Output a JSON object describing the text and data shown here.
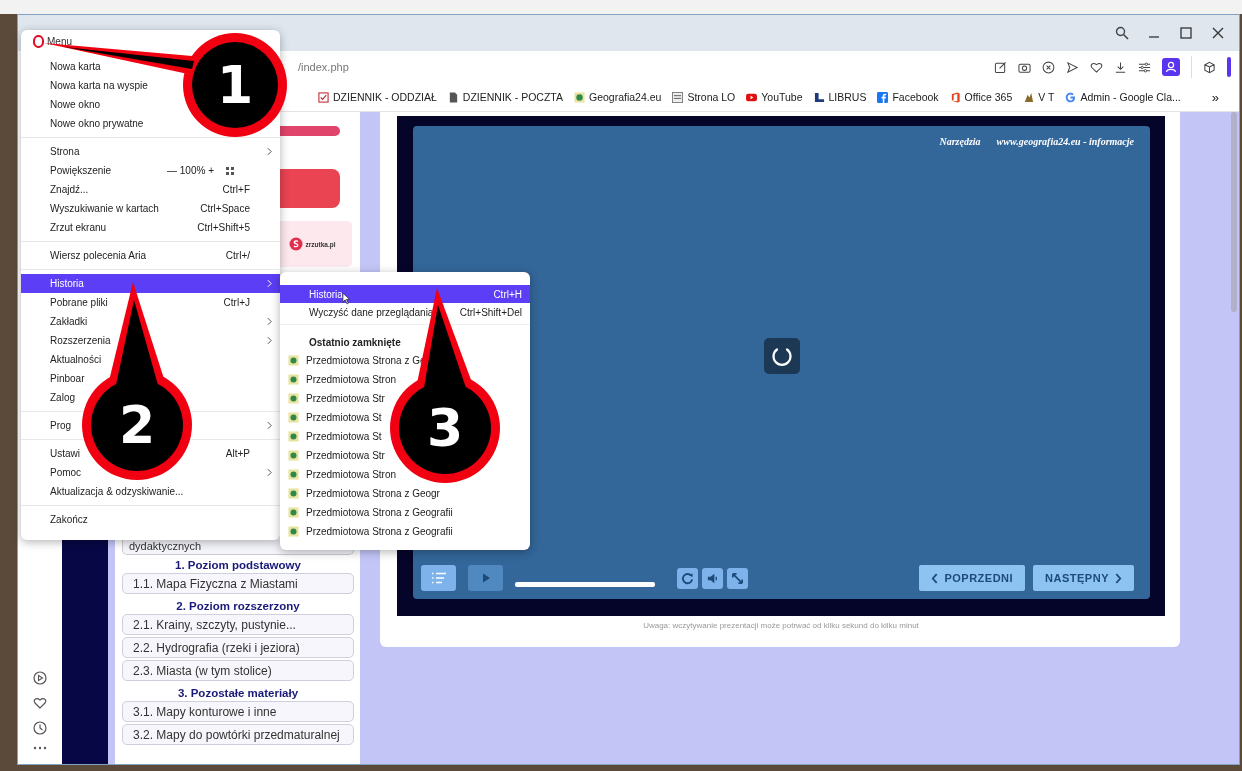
{
  "address_bar": {
    "url": "/index.php"
  },
  "bookmarks": [
    {
      "label": "DZIENNIK - ODDZIAŁ",
      "kind": "check"
    },
    {
      "label": "DZIENNIK - POCZTA",
      "kind": "doc"
    },
    {
      "label": "Geografia24.eu",
      "kind": "geo"
    },
    {
      "label": "Strona LO",
      "kind": "school"
    },
    {
      "label": "YouTube",
      "kind": "youtube"
    },
    {
      "label": "LIBRUS",
      "kind": "librus"
    },
    {
      "label": "Facebook",
      "kind": "facebook"
    },
    {
      "label": "Office 365",
      "kind": "office"
    },
    {
      "label": "V T",
      "kind": "vt"
    },
    {
      "label": "Admin - Google Cla...",
      "kind": "google"
    }
  ],
  "more_bookmarks": "»",
  "menu": {
    "title": "Menu",
    "groups": [
      {
        "items": [
          {
            "kind": "item",
            "label": "Nowa karta",
            "submenu": false,
            "selected": false
          },
          {
            "kind": "item",
            "label": "Nowa karta na wyspie",
            "submenu": false,
            "selected": false
          },
          {
            "kind": "item",
            "label": "Nowe okno",
            "submenu": false,
            "selected": false
          },
          {
            "kind": "item",
            "label": "Nowe okno prywatne",
            "submenu": false,
            "selected": false
          }
        ]
      },
      {
        "items": [
          {
            "kind": "item",
            "label": "Strona",
            "submenu": true,
            "selected": false
          },
          {
            "kind": "zoom",
            "label": "Powiększenie",
            "minus": "—",
            "value": "100%",
            "plus": "+",
            "submenu": false,
            "selected": false
          },
          {
            "kind": "item",
            "label": "Znajdź...",
            "shortcut": "Ctrl+F",
            "submenu": false,
            "selected": false
          },
          {
            "kind": "item",
            "label": "Wyszukiwanie w kartach",
            "shortcut": "Ctrl+Space",
            "submenu": false,
            "selected": false
          },
          {
            "kind": "item",
            "label": "Zrzut ekranu",
            "shortcut": "Ctrl+Shift+5",
            "submenu": false,
            "selected": false
          }
        ]
      },
      {
        "items": [
          {
            "kind": "item",
            "label": "Wiersz polecenia Aria",
            "shortcut": "Ctrl+/",
            "submenu": false,
            "selected": false
          }
        ]
      },
      {
        "items": [
          {
            "kind": "item",
            "label": "Historia",
            "submenu": true,
            "selected": true
          },
          {
            "kind": "item",
            "label": "Pobrane pliki",
            "shortcut": "Ctrl+J",
            "submenu": false,
            "selected": false
          },
          {
            "kind": "item",
            "label": "Zakładki",
            "submenu": true,
            "selected": false
          },
          {
            "kind": "item",
            "label": "Rozszerzenia",
            "submenu": true,
            "selected": false
          },
          {
            "kind": "item",
            "label": "Aktualności",
            "submenu": false,
            "selected": false
          },
          {
            "kind": "item",
            "label": "Pinboar",
            "submenu": false,
            "selected": false
          },
          {
            "kind": "item",
            "label": "Zalog",
            "submenu": false,
            "selected": false
          }
        ]
      },
      {
        "items": [
          {
            "kind": "item",
            "label": "Prog",
            "submenu": true,
            "selected": false
          }
        ]
      },
      {
        "items": [
          {
            "kind": "item",
            "label": "Ustawi",
            "shortcut": "Alt+P",
            "submenu": false,
            "selected": false
          },
          {
            "kind": "item",
            "label": "Pomoc",
            "submenu": true,
            "selected": false
          },
          {
            "kind": "item",
            "label": "Aktualizacja & odzyskiwanie...",
            "submenu": false,
            "selected": false
          }
        ]
      },
      {
        "items": [
          {
            "kind": "item",
            "label": "Zakończ",
            "submenu": false,
            "selected": false
          }
        ]
      }
    ]
  },
  "history_submenu": {
    "actions": [
      {
        "label": "Historia",
        "shortcut": "Ctrl+H",
        "selected": true
      },
      {
        "label": "Wyczyść dane przeglądania",
        "shortcut": "Ctrl+Shift+Del",
        "selected": false
      }
    ],
    "section_title": "Ostatnio zamknięte",
    "recent": [
      {
        "label": "Przedmiotowa Strona z Ge",
        "selected": false
      },
      {
        "label": "Przedmiotowa Stron",
        "selected": false
      },
      {
        "label": "Przedmiotowa Str",
        "selected": false
      },
      {
        "label": "Przedmiotowa St",
        "selected": false
      },
      {
        "label": "Przedmiotowa St",
        "selected": false
      },
      {
        "label": "Przedmiotowa Str",
        "selected": false
      },
      {
        "label": "Przedmiotowa Stron",
        "selected": false
      },
      {
        "label": "Przedmiotowa Strona z Geogr",
        "selected": false
      },
      {
        "label": "Przedmiotowa Strona z Geografii",
        "selected": false
      },
      {
        "label": "Przedmiotowa Strona z Geografii",
        "selected": false
      }
    ]
  },
  "left_panel": {
    "donate_label": "zrzutka.pl",
    "cut_text": "dydaktycznych",
    "sections": [
      {
        "heading": "1. Poziom podstawowy",
        "links": [
          "1.1. Mapa Fizyczna z Miastami"
        ]
      },
      {
        "heading": "2. Poziom rozszerzony",
        "links": [
          "2.1. Krainy, szczyty, pustynie...",
          "2.2. Hydrografia (rzeki i jeziora)",
          "2.3. Miasta (w tym stolice)"
        ]
      },
      {
        "heading": "3. Pozostałe materiały",
        "links": [
          "3.1. Mapy konturowe i inne",
          "3.2. Mapy do powtórki przedmaturalnej"
        ]
      }
    ]
  },
  "presentation": {
    "header_links": [
      "Narzędzia",
      "www.geografia24.eu - informacje"
    ],
    "prev": "POPRZEDNI",
    "next": "NASTĘPNY",
    "note": "Uwaga: wczytywanie prezentacji może potrwać od kilku sekund do kilku minut"
  },
  "callouts": [
    "1",
    "2",
    "3"
  ]
}
